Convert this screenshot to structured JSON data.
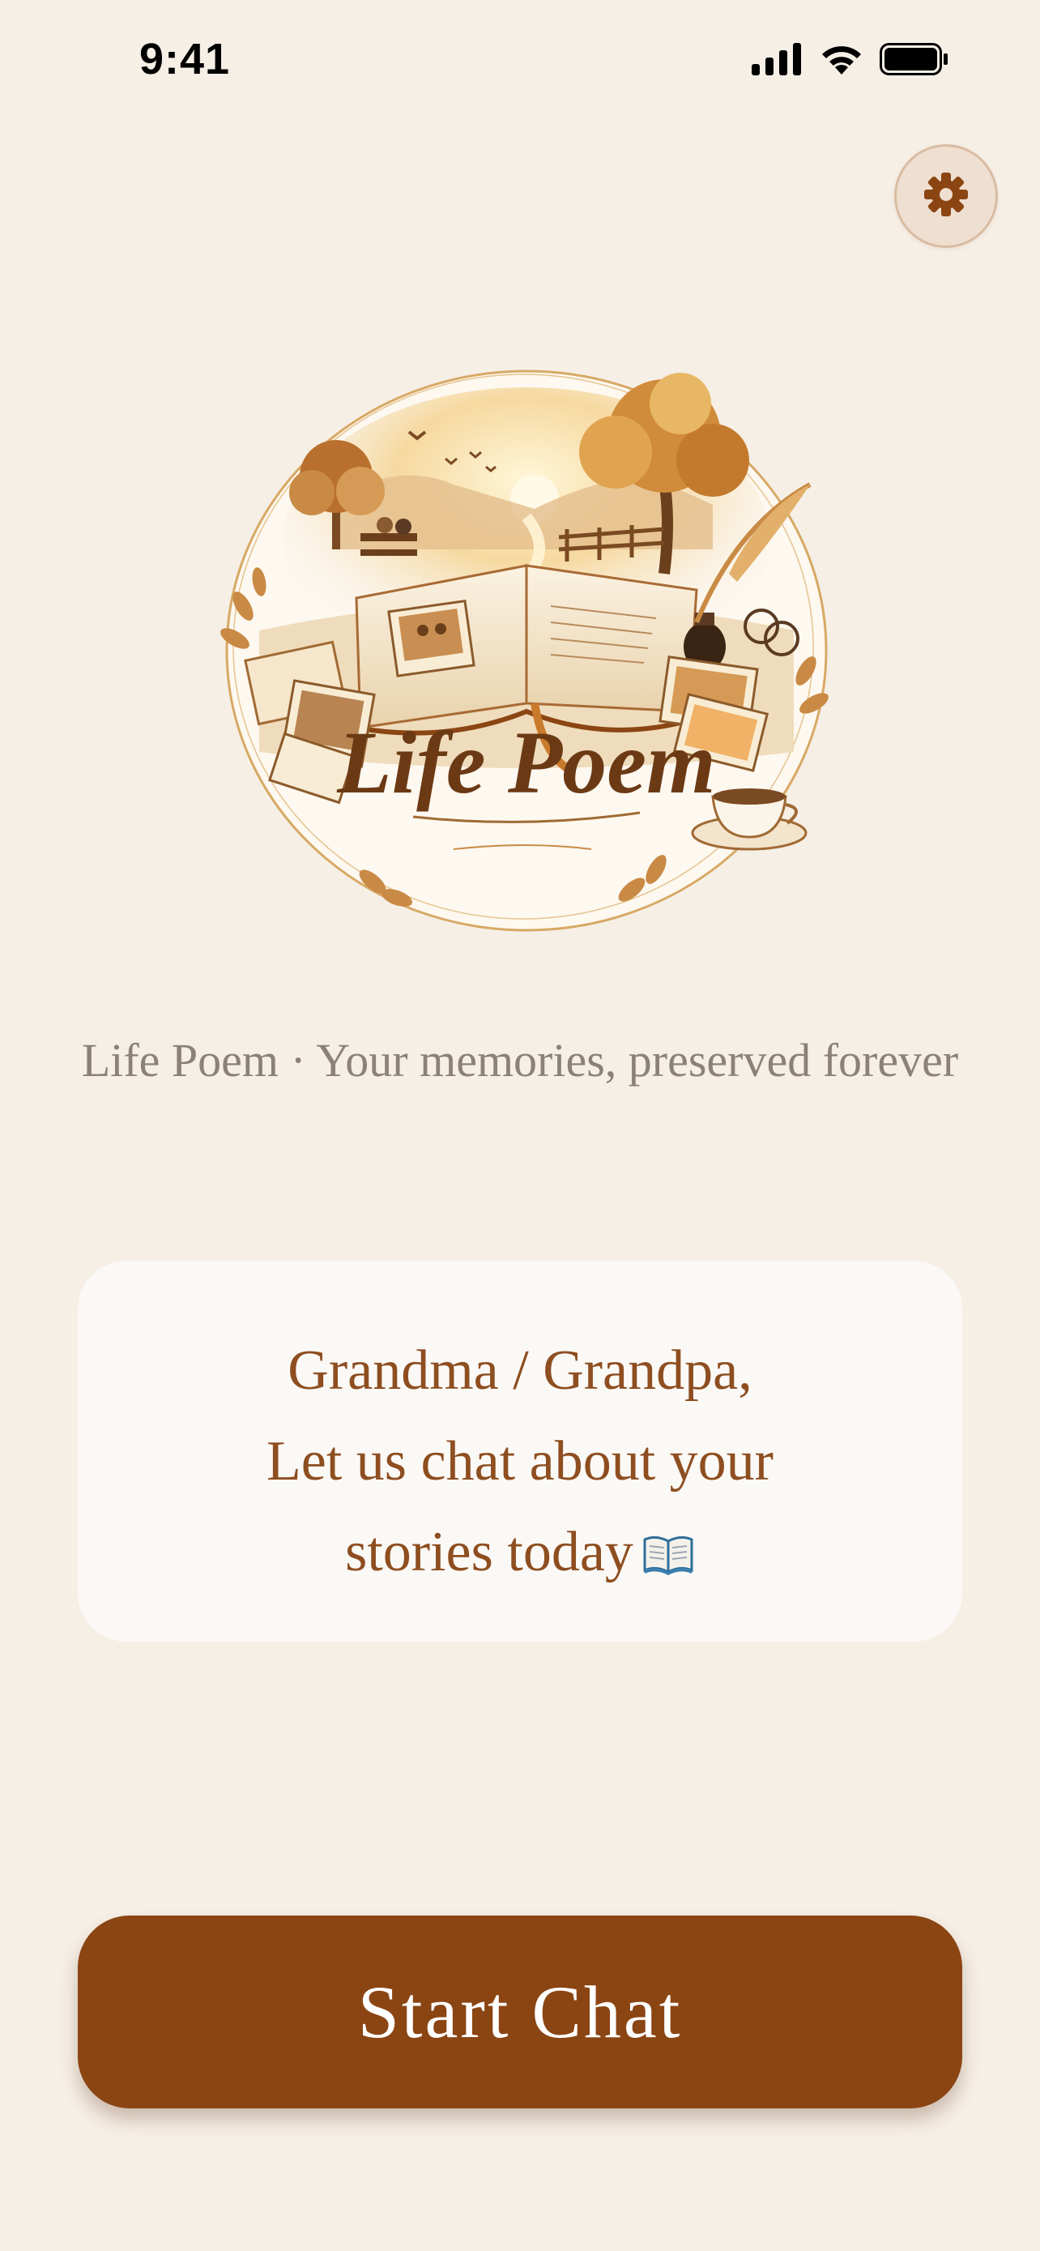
{
  "status_bar": {
    "time": "9:41",
    "icons": [
      "signal-icon",
      "wifi-icon",
      "battery-icon"
    ]
  },
  "header": {
    "settings_icon": "gear-icon"
  },
  "logo": {
    "text": "Life Poem"
  },
  "tagline": "Life Poem · Your memories, preserved forever",
  "greeting": {
    "line1": "Grandma / Grandpa,",
    "line2": "Let us chat about your",
    "line3": "stories today",
    "emoji_icon": "open-book-icon"
  },
  "start_button": {
    "label": "Start Chat"
  },
  "colors": {
    "background": "#f6efe6",
    "accent": "#8b4513",
    "greeting_text": "#8e4e20",
    "tagline_text": "#8b8177"
  }
}
